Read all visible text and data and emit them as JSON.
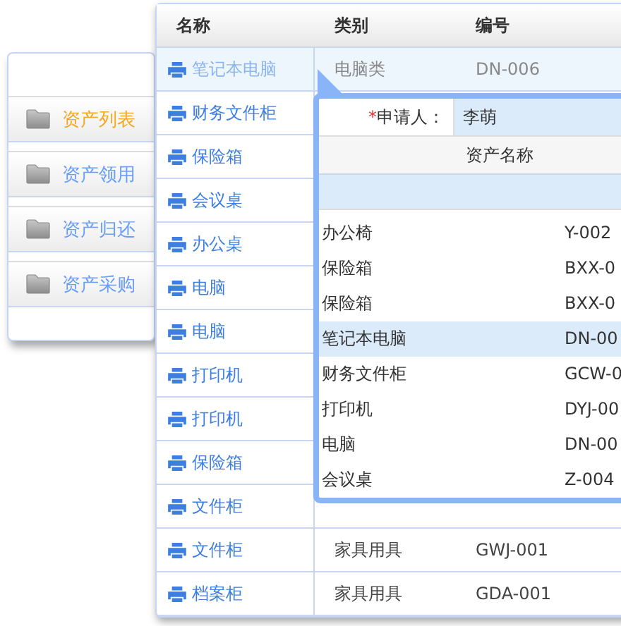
{
  "sidebar": {
    "items": [
      {
        "label": "资产列表",
        "selected": true
      },
      {
        "label": "资产领用",
        "selected": false
      },
      {
        "label": "资产归还",
        "selected": false
      },
      {
        "label": "资产采购",
        "selected": false
      }
    ]
  },
  "table": {
    "columns": [
      "名称",
      "类别",
      "编号"
    ],
    "rows": [
      {
        "name": "笔记本电脑",
        "category": "电脑类",
        "code": "DN-006",
        "selected": true
      },
      {
        "name": "财务文件柜",
        "selected": false
      },
      {
        "name": "保险箱",
        "selected": false
      },
      {
        "name": "会议桌",
        "selected": false
      },
      {
        "name": "办公桌",
        "selected": false
      },
      {
        "name": "电脑",
        "selected": false
      },
      {
        "name": "电脑",
        "selected": false
      },
      {
        "name": "打印机",
        "selected": false
      },
      {
        "name": "打印机",
        "selected": false
      },
      {
        "name": "保险箱",
        "selected": false
      },
      {
        "name": "文件柜",
        "selected": false
      },
      {
        "name": "文件柜",
        "category": "家具用具",
        "code": "GWJ-001",
        "selected": false
      },
      {
        "name": "档案柜",
        "category": "家具用具",
        "code": "GDA-001",
        "selected": false
      }
    ]
  },
  "popup": {
    "applicant": {
      "required_mark": "*",
      "label": "申请人：",
      "value": "李萌"
    },
    "column": "资产名称",
    "rows": [
      {
        "name": "办公椅",
        "code": "Y-002",
        "selected": false
      },
      {
        "name": "保险箱",
        "code": "BXX-0",
        "selected": false
      },
      {
        "name": "保险箱",
        "code": "BXX-0",
        "selected": false
      },
      {
        "name": "笔记本电脑",
        "code": "DN-00",
        "selected": true
      },
      {
        "name": "财务文件柜",
        "code": "GCW-0",
        "selected": false
      },
      {
        "name": "打印机",
        "code": "DYJ-00",
        "selected": false
      },
      {
        "name": "电脑",
        "code": "DN-00",
        "selected": false
      },
      {
        "name": "会议桌",
        "code": "Z-004",
        "selected": false
      }
    ]
  }
}
